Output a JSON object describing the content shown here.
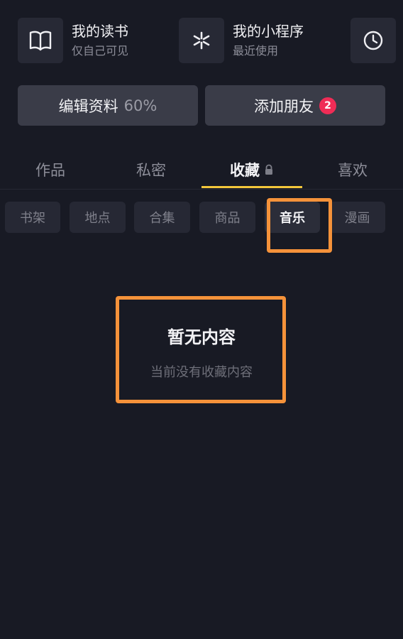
{
  "quick": {
    "reading": {
      "title": "我的读书",
      "subtitle": "仅自己可见",
      "icon": "book-icon"
    },
    "mini_programs": {
      "title": "我的小程序",
      "subtitle": "最近使用",
      "icon": "asterisk-icon"
    },
    "history_icon": "clock-icon"
  },
  "actions": {
    "edit_profile": {
      "label": "编辑资料",
      "percent": "60%"
    },
    "add_friends": {
      "label": "添加朋友",
      "badge": "2"
    }
  },
  "tabs": [
    {
      "label": "作品"
    },
    {
      "label": "私密"
    },
    {
      "label": "收藏",
      "icon": "lock-icon",
      "active": true
    },
    {
      "label": "喜欢"
    }
  ],
  "chips": [
    {
      "label": "书架"
    },
    {
      "label": "地点"
    },
    {
      "label": "合集"
    },
    {
      "label": "商品"
    },
    {
      "label": "音乐",
      "active": true
    },
    {
      "label": "漫画"
    }
  ],
  "empty": {
    "title": "暂无内容",
    "subtitle": "当前没有收藏内容"
  },
  "colors": {
    "background": "#181a24",
    "accent_underline": "#f4c73b",
    "badge": "#f02c56",
    "highlight": "#f5923a"
  }
}
